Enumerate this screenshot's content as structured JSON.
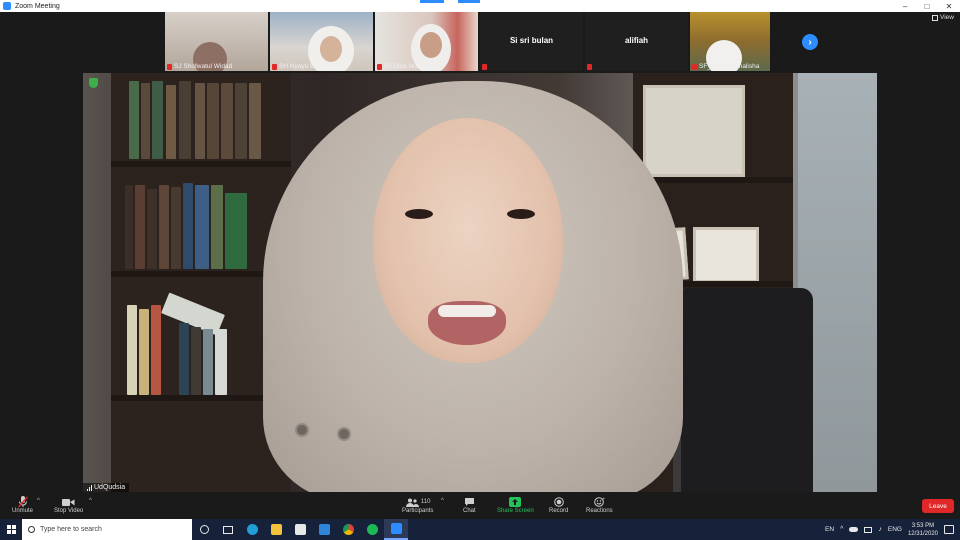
{
  "window": {
    "title": "Zoom Meeting",
    "view_label": "View",
    "minimize_icon": "minimize-icon",
    "maximize_icon": "maximize-icon",
    "close_icon": "close-icon"
  },
  "thumbnails": [
    {
      "name": "SJ Shofwatul Widad",
      "video": true,
      "muted": true
    },
    {
      "name": "SH Nyayu Lutfia M...",
      "video": true,
      "muted": true
    },
    {
      "name": "SJ Dina Nurzain",
      "video": true,
      "muted": true
    },
    {
      "name": "Si sri bulan",
      "video": false,
      "muted": true
    },
    {
      "name": "alifiah",
      "video": false,
      "muted": true
    },
    {
      "name": "SF_khansa_chalisha",
      "video": true,
      "muted": true
    }
  ],
  "speaker": {
    "name": "UdQudsia"
  },
  "toolbar": {
    "unmute": "Unmute",
    "stop_video": "Stop Video",
    "participants": "Participants",
    "participants_count": "110",
    "chat": "Chat",
    "share_screen": "Share Screen",
    "record": "Record",
    "reactions": "Reactions",
    "leave": "Leave"
  },
  "taskbar": {
    "search_placeholder": "Type here to search",
    "language": "EN",
    "ime": "ENG",
    "time": "3:53 PM",
    "date": "12/31/2020"
  },
  "colors": {
    "zoom_blue": "#2d8cff",
    "leave_red": "#e02828",
    "share_green": "#25c25a",
    "taskbar_bg": "#16213a"
  }
}
